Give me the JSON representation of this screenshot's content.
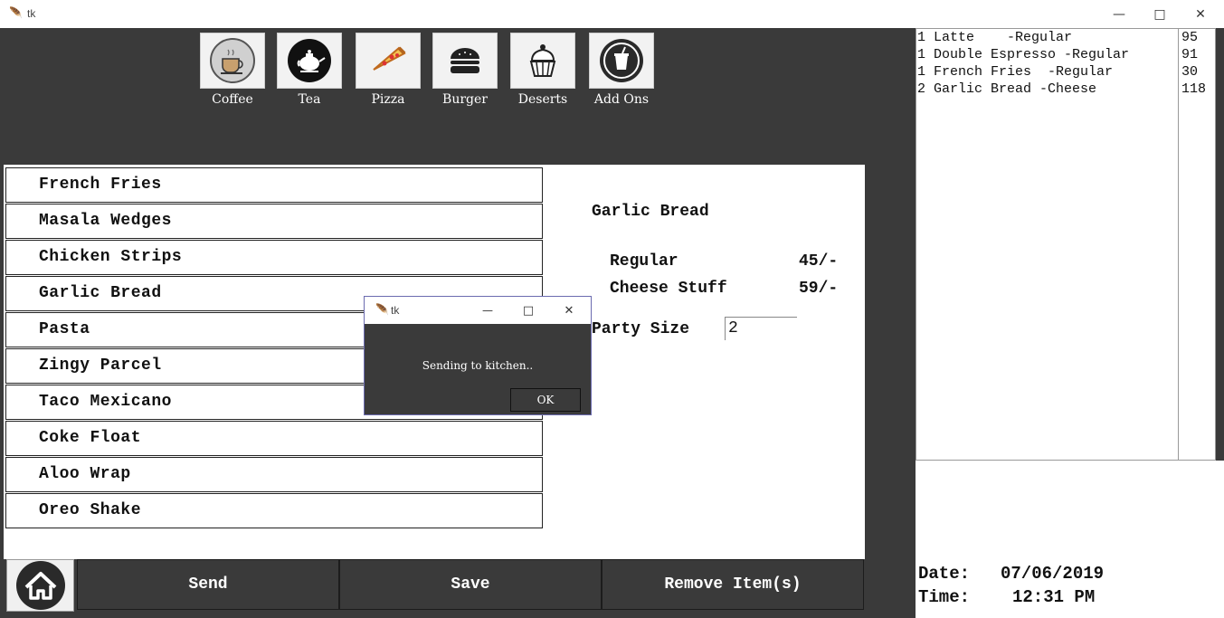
{
  "window": {
    "title": "tk",
    "controls": {
      "minimize_icon": "minimize-icon",
      "maximize_icon": "maximize-icon",
      "close_icon": "close-icon"
    }
  },
  "categories": [
    {
      "label": "Coffee",
      "icon": "coffee-cup-icon"
    },
    {
      "label": "Tea",
      "icon": "teapot-icon"
    },
    {
      "label": "Pizza",
      "icon": "pizza-slice-icon"
    },
    {
      "label": "Burger",
      "icon": "burger-icon"
    },
    {
      "label": "Deserts",
      "icon": "cupcake-icon"
    },
    {
      "label": "Add Ons",
      "icon": "drink-cup-icon"
    }
  ],
  "menu_items": [
    "French Fries",
    "Masala Wedges",
    "Chicken Strips",
    "Garlic Bread",
    "Pasta",
    "Zingy Parcel",
    "Taco Mexicano",
    "Coke Float",
    "Aloo Wrap",
    "Oreo Shake"
  ],
  "detail": {
    "item_name": "Garlic Bread",
    "options": [
      {
        "name": "Regular",
        "price": "45/-"
      },
      {
        "name": "Cheese Stuff",
        "price": "59/-"
      }
    ],
    "party_size_label": "Party Size",
    "party_size_value": "2"
  },
  "buttons": {
    "home_icon": "home-icon",
    "send": "Send",
    "save": "Save",
    "remove": "Remove Item(s)"
  },
  "order": {
    "items": [
      {
        "text": "1 Latte    -Regular",
        "price": "95"
      },
      {
        "text": "1 Double Espresso -Regular",
        "price": "91"
      },
      {
        "text": "1 French Fries  -Regular",
        "price": "30"
      },
      {
        "text": "2 Garlic Bread -Cheese",
        "price": "118"
      }
    ]
  },
  "datetime": {
    "date_label": "Date:",
    "date_value": "07/06/2019",
    "time_label": "Time:",
    "time_value": "12:31 PM"
  },
  "dialog": {
    "title": "tk",
    "message": "Sending to kitchen..",
    "ok_label": "OK"
  },
  "colors": {
    "app_background": "#3a3a3a",
    "panel_background": "#ffffff",
    "dialog_border": "#6b6bb0"
  }
}
